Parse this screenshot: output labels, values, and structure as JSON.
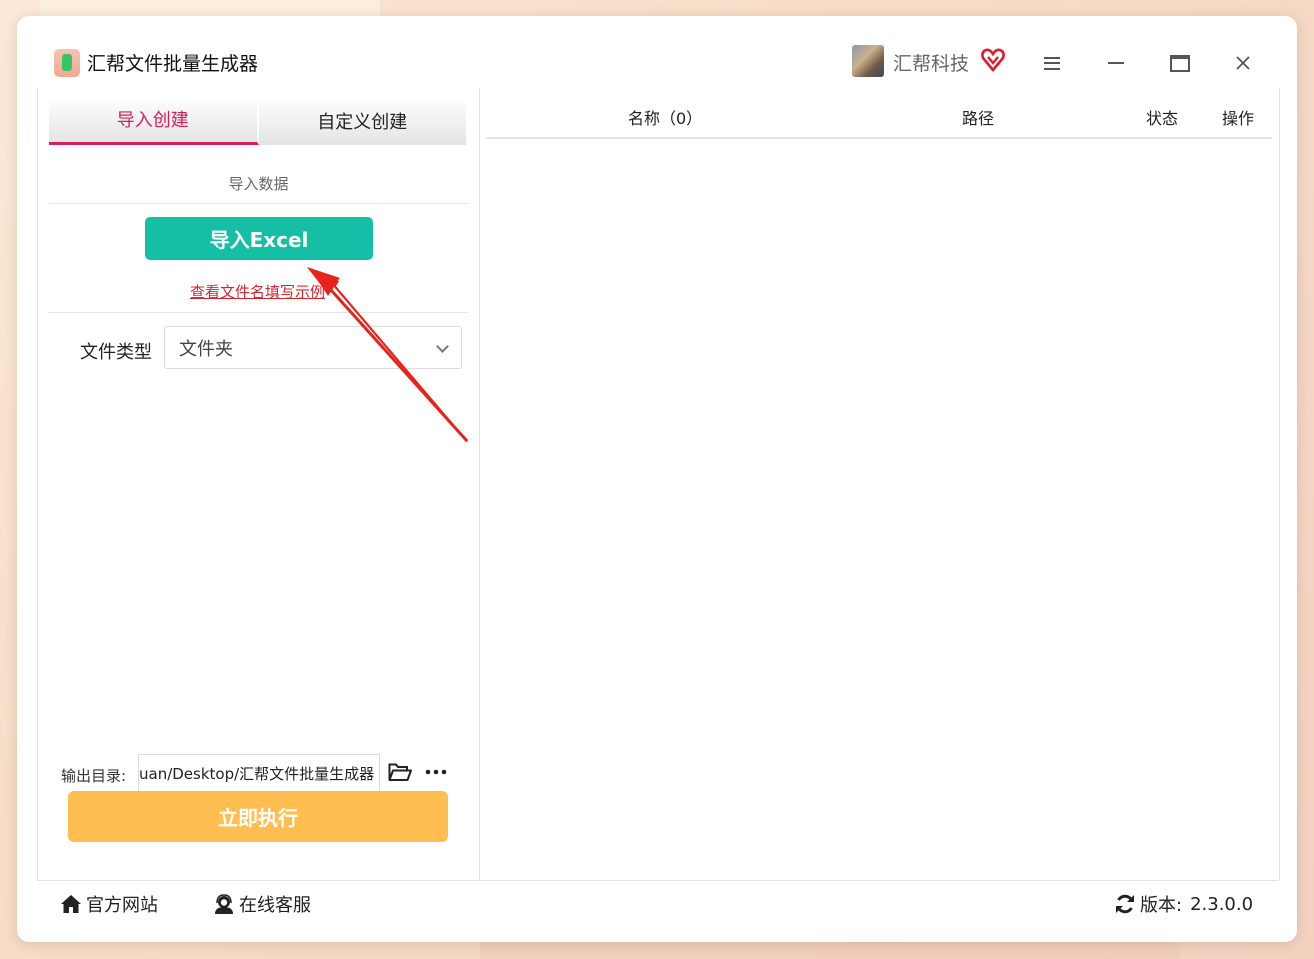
{
  "window": {
    "title": "汇帮文件批量生成器",
    "brand": "汇帮科技",
    "icons": {
      "app": "app-logo-icon",
      "avatar": "avatar",
      "vip": "vip-heart-icon",
      "menu": "hamburger-menu-icon",
      "minimize": "minimize-icon",
      "maximize": "maximize-icon",
      "close": "close-icon"
    }
  },
  "left_panel": {
    "tabs": [
      {
        "label": "导入创建",
        "active": true
      },
      {
        "label": "自定义创建",
        "active": false
      }
    ],
    "section_label": "导入数据",
    "import_button": "导入Excel",
    "sample_link": "查看文件名填写示例",
    "file_type": {
      "label": "文件类型",
      "selected": "文件夹"
    },
    "output": {
      "label": "输出目录:",
      "value": "uan/Desktop/汇帮文件批量生成器"
    },
    "run_button": "立即执行"
  },
  "table": {
    "columns": [
      "名称（0）",
      "路径",
      "状态",
      "操作"
    ],
    "rows": []
  },
  "footer": {
    "website": "官方网站",
    "service": "在线客服",
    "version_label": "版本:",
    "version": "2.3.0.0"
  },
  "colors": {
    "accent_tab": "#d81e5b",
    "import_button": "#15bfa6",
    "run_button": "#ffbe4f",
    "link": "#d8262b",
    "annotation_arrow": "#e8231c"
  }
}
